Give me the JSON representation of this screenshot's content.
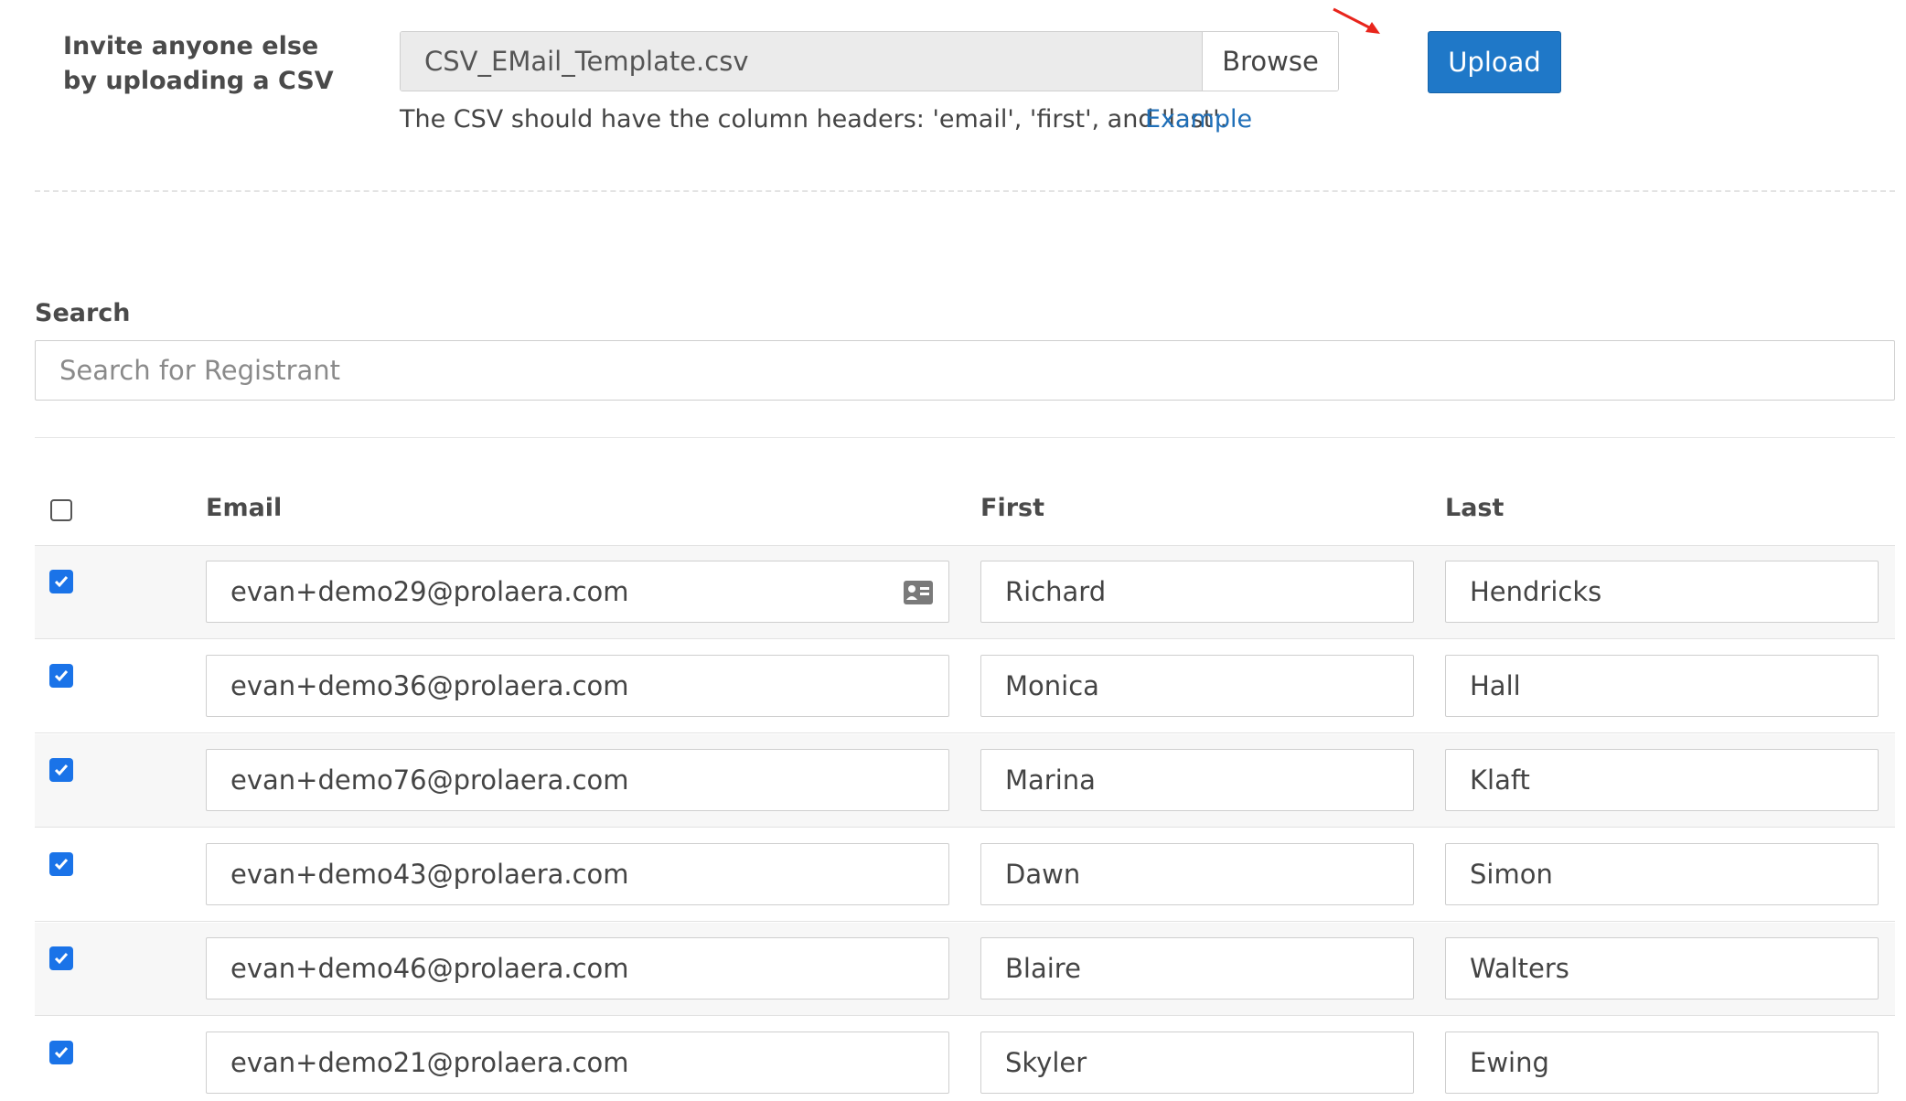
{
  "upload": {
    "label": "Invite anyone else by uploading a CSV",
    "file_name": "CSV_EMail_Template.csv",
    "browse_label": "Browse",
    "upload_label": "Upload",
    "hint": "The CSV should have the column headers: 'email', 'first', and 'last'.",
    "example_label": "Example"
  },
  "search": {
    "label": "Search",
    "placeholder": "Search for Registrant"
  },
  "table": {
    "headers": {
      "email": "Email",
      "first": "First",
      "last": "Last"
    },
    "rows": [
      {
        "email": "evan+demo29@prolaera.com",
        "first": "Richard",
        "last": "Hendricks",
        "checked": true
      },
      {
        "email": "evan+demo36@prolaera.com",
        "first": "Monica",
        "last": "Hall",
        "checked": true
      },
      {
        "email": "evan+demo76@prolaera.com",
        "first": "Marina",
        "last": "Klaft",
        "checked": true
      },
      {
        "email": "evan+demo43@prolaera.com",
        "first": "Dawn",
        "last": "Simon",
        "checked": true
      },
      {
        "email": "evan+demo46@prolaera.com",
        "first": "Blaire",
        "last": "Walters",
        "checked": true
      },
      {
        "email": "evan+demo21@prolaera.com",
        "first": "Skyler",
        "last": "Ewing",
        "checked": true
      }
    ]
  },
  "icons": {
    "row_checkbox": "checkmark-icon",
    "email_autofill": "contact-card-icon",
    "annotation": "red-arrow-icon"
  },
  "colors": {
    "accent": "#1f78c8",
    "link": "#1f6fb8",
    "checkbox": "#1a73e8",
    "annotation_arrow": "#e8251c"
  }
}
